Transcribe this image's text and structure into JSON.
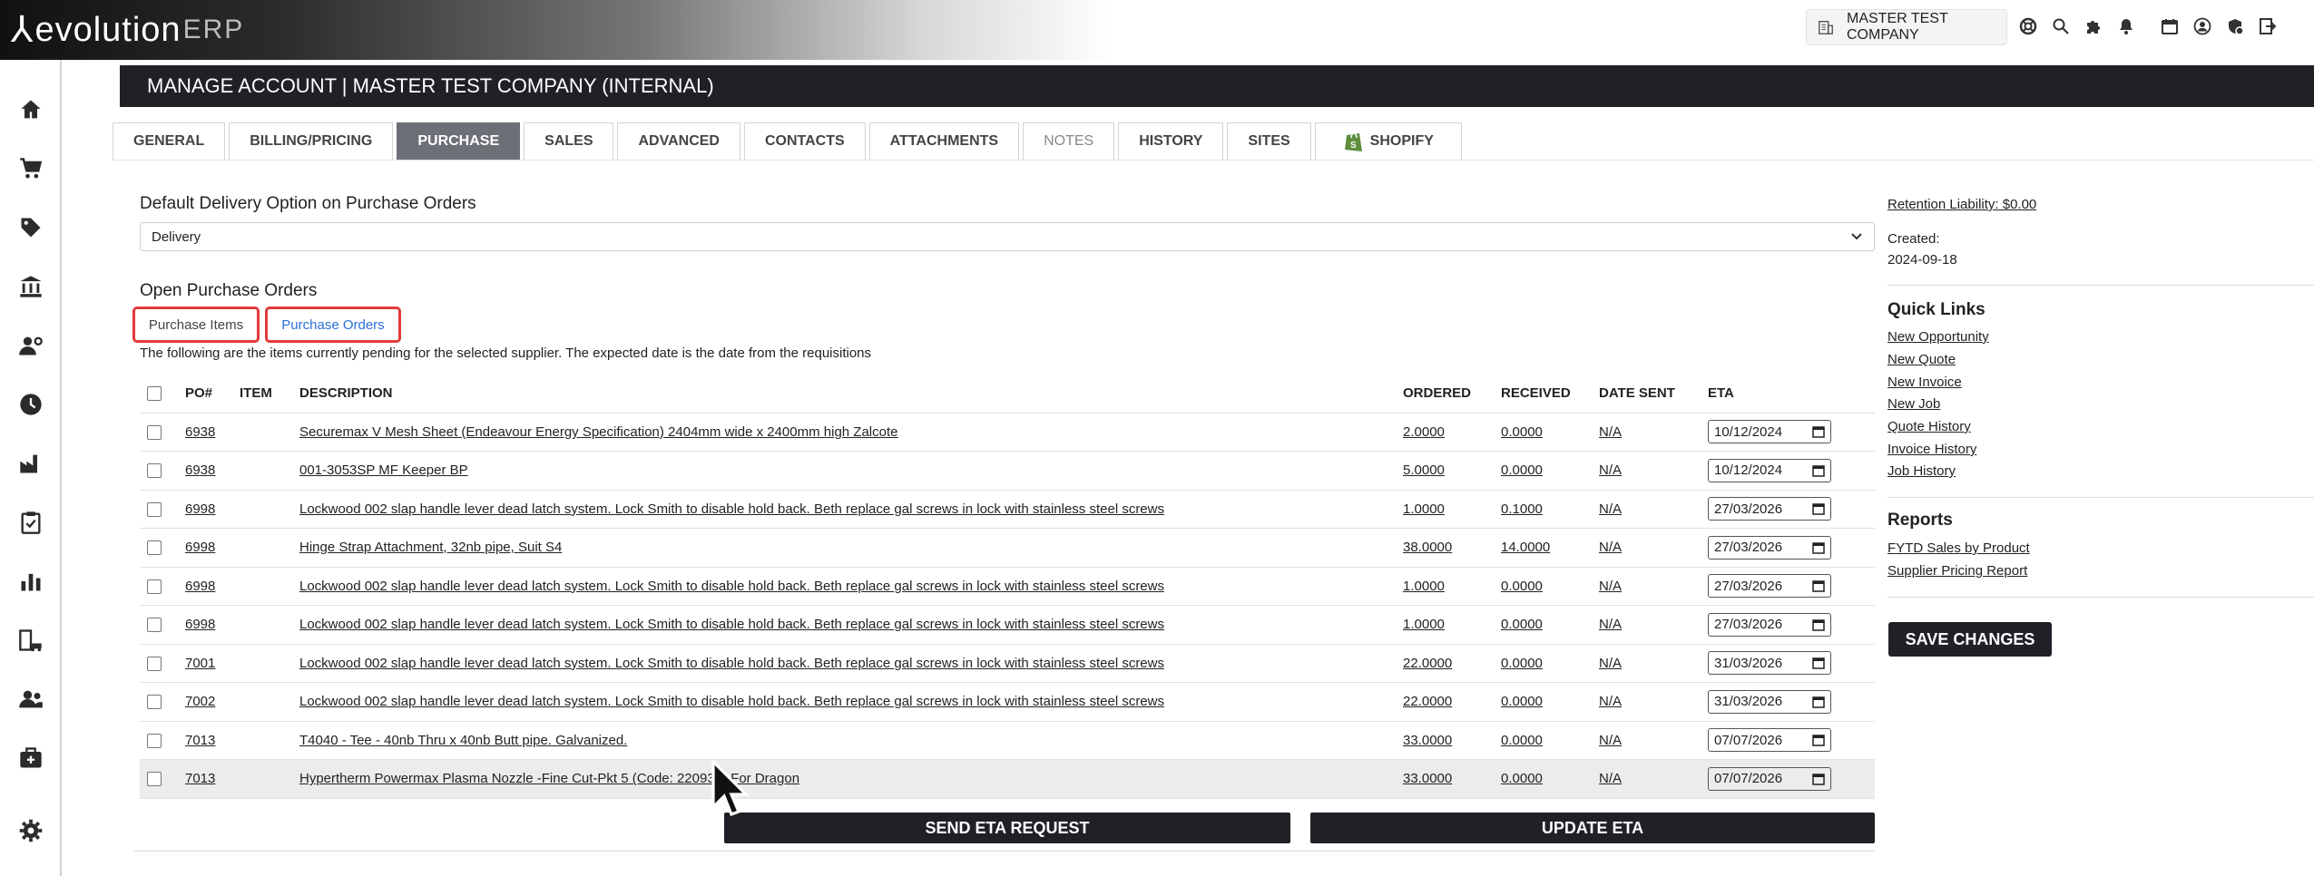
{
  "app": {
    "logo_word": "evolution",
    "logo_suffix": "ERP",
    "company": "MASTER TEST COMPANY",
    "top_icons": [
      "support-icon",
      "search-icon",
      "puzzle-icon",
      "bell-icon",
      "calendar-icon",
      "user-icon",
      "shield-badge-icon",
      "logout-icon"
    ]
  },
  "nav": [
    "home-icon",
    "cart-icon",
    "tag-icon",
    "bank-icon",
    "user-settings-icon",
    "clock-icon",
    "factory-icon",
    "clipboard-check-icon",
    "bar-chart-icon",
    "building-car-icon",
    "users-icon",
    "medical-kit-icon",
    "gear-icon"
  ],
  "header": {
    "title": "MANAGE ACCOUNT | MASTER TEST COMPANY (INTERNAL)"
  },
  "tabs": [
    {
      "label": "GENERAL"
    },
    {
      "label": "BILLING/PRICING"
    },
    {
      "label": "PURCHASE"
    },
    {
      "label": "SALES"
    },
    {
      "label": "ADVANCED"
    },
    {
      "label": "CONTACTS"
    },
    {
      "label": "ATTACHMENTS"
    },
    {
      "label": "NOTES"
    },
    {
      "label": "HISTORY"
    },
    {
      "label": "SITES"
    },
    {
      "label": "SHOPIFY"
    }
  ],
  "delivery": {
    "label": "Default Delivery Option on Purchase Orders",
    "value": "Delivery"
  },
  "open_po": {
    "label": "Open Purchase Orders",
    "subtab_items": "Purchase Items",
    "subtab_orders": "Purchase Orders",
    "note": "The following are the items currently pending for the selected supplier. The expected date is the date from the requisitions"
  },
  "table": {
    "columns": {
      "po": "PO#",
      "item": "ITEM",
      "description": "DESCRIPTION",
      "ordered": "ORDERED",
      "received": "RECEIVED",
      "date_sent": "DATE SENT",
      "eta": "ETA"
    },
    "rows": [
      {
        "po": "6938",
        "item": "",
        "description": "Securemax V Mesh Sheet (Endeavour Energy Specification) 2404mm wide x 2400mm high Zalcote",
        "ordered": "2.0000",
        "received": "0.0000",
        "date_sent": "N/A",
        "eta": "10/12/2024"
      },
      {
        "po": "6938",
        "item": "",
        "description": "001-3053SP MF Keeper BP",
        "ordered": "5.0000",
        "received": "0.0000",
        "date_sent": "N/A",
        "eta": "10/12/2024"
      },
      {
        "po": "6998",
        "item": "",
        "description": "Lockwood 002 slap handle lever dead latch system. Lock Smith to disable hold back. Beth replace gal screws in lock with stainless steel screws",
        "ordered": "1.0000",
        "received": "0.1000",
        "date_sent": "N/A",
        "eta": "27/03/2026"
      },
      {
        "po": "6998",
        "item": "",
        "description": "Hinge Strap Attachment, 32nb pipe, Suit S4",
        "ordered": "38.0000",
        "received": "14.0000",
        "date_sent": "N/A",
        "eta": "27/03/2026"
      },
      {
        "po": "6998",
        "item": "",
        "description": "Lockwood 002 slap handle lever dead latch system. Lock Smith to disable hold back. Beth replace gal screws in lock with stainless steel screws",
        "ordered": "1.0000",
        "received": "0.0000",
        "date_sent": "N/A",
        "eta": "27/03/2026"
      },
      {
        "po": "6998",
        "item": "",
        "description": "Lockwood 002 slap handle lever dead latch system. Lock Smith to disable hold back. Beth replace gal screws in lock with stainless steel screws",
        "ordered": "1.0000",
        "received": "0.0000",
        "date_sent": "N/A",
        "eta": "27/03/2026"
      },
      {
        "po": "7001",
        "item": "",
        "description": "Lockwood 002 slap handle lever dead latch system. Lock Smith to disable hold back. Beth replace gal screws in lock with stainless steel screws",
        "ordered": "22.0000",
        "received": "0.0000",
        "date_sent": "N/A",
        "eta": "31/03/2026"
      },
      {
        "po": "7002",
        "item": "",
        "description": "Lockwood 002 slap handle lever dead latch system. Lock Smith to disable hold back. Beth replace gal screws in lock with stainless steel screws",
        "ordered": "22.0000",
        "received": "0.0000",
        "date_sent": "N/A",
        "eta": "31/03/2026"
      },
      {
        "po": "7013",
        "item": "",
        "description": "T4040 - Tee - 40nb Thru x 40nb Butt pipe. Galvanized.",
        "ordered": "33.0000",
        "received": "0.0000",
        "date_sent": "N/A",
        "eta": "07/07/2026"
      },
      {
        "po": "7013",
        "item": "",
        "description": "Hypertherm Powermax Plasma Nozzle -Fine Cut-Pkt 5 (Code: 220930) For Dragon",
        "ordered": "33.0000",
        "received": "0.0000",
        "date_sent": "N/A",
        "eta": "07/07/2026"
      }
    ]
  },
  "buttons": {
    "send_eta": "SEND ETA REQUEST",
    "update_eta": "UPDATE ETA",
    "save": "SAVE CHANGES"
  },
  "right_panel": {
    "retention": "Retention Liability: $0.00",
    "created_label": "Created:",
    "created_value": "2024-09-18",
    "quick_links_title": "Quick Links",
    "quick_links": [
      "New Opportunity",
      "New Quote",
      "New Invoice",
      "New Job",
      "Quote History",
      "Invoice History",
      "Job History"
    ],
    "reports_title": "Reports",
    "reports": [
      "FYTD Sales by Product",
      "Supplier Pricing Report"
    ]
  },
  "colors": {
    "dark": "#1f2126",
    "active_tab": "#6c6f76",
    "highlight_border": "#e03a3a",
    "link_blue": "#2a6fd6"
  }
}
